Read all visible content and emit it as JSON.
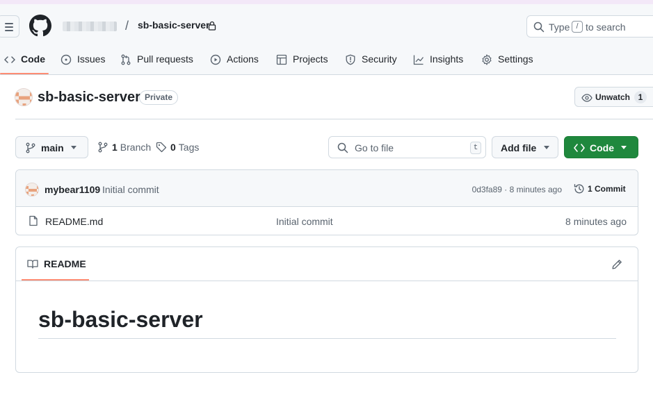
{
  "header": {
    "repo_name": "sb-basic-server",
    "separator": "/",
    "search": {
      "prefix": "Type",
      "key": "/",
      "suffix": "to search"
    }
  },
  "tabs": [
    {
      "label": "Code",
      "icon": "code-icon",
      "selected": true
    },
    {
      "label": "Issues",
      "icon": "issue-icon"
    },
    {
      "label": "Pull requests",
      "icon": "pull-request-icon"
    },
    {
      "label": "Actions",
      "icon": "play-icon"
    },
    {
      "label": "Projects",
      "icon": "table-icon"
    },
    {
      "label": "Security",
      "icon": "shield-icon"
    },
    {
      "label": "Insights",
      "icon": "graph-icon"
    },
    {
      "label": "Settings",
      "icon": "gear-icon"
    }
  ],
  "repo": {
    "title": "sb-basic-server",
    "visibility": "Private",
    "watch_label": "Unwatch",
    "watch_count": "1"
  },
  "toolbar": {
    "branch": "main",
    "branch_count": "1",
    "branch_label": "Branch",
    "tag_count": "0",
    "tag_label": "Tags",
    "goto_placeholder": "Go to file",
    "goto_key": "t",
    "add_file_label": "Add file",
    "code_label": "Code"
  },
  "latest_commit": {
    "author": "mybear1109",
    "message": "Initial commit",
    "meta": "0d3fa89 · 8 minutes ago",
    "count_label": "1 Commit"
  },
  "files": [
    {
      "name": "README.md",
      "commit": "Initial commit",
      "time": "8 minutes ago",
      "icon": "file-icon"
    }
  ],
  "readme": {
    "tab_label": "README",
    "heading": "sb-basic-server"
  },
  "colors": {
    "accent_underline": "#fd8c73",
    "primary_button": "#1f883d",
    "header_bg": "#f6f8fa"
  }
}
